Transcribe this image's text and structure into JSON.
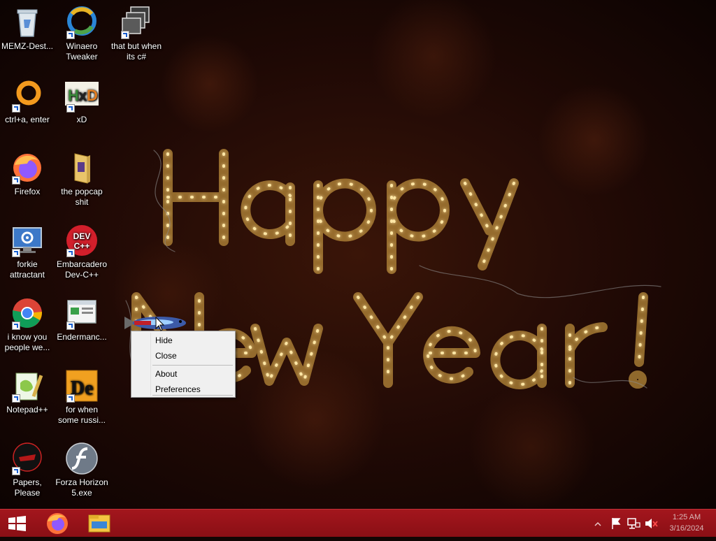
{
  "desktop_icons": [
    {
      "label": "MEMZ-Dest...",
      "icon": "recycle-bin-icon"
    },
    {
      "label": "Winaero Tweaker",
      "icon": "winaero-icon"
    },
    {
      "label": "that but when its c#",
      "icon": "stacked-windows-icon"
    },
    {
      "label": "ctrl+a, enter",
      "icon": "orange-ring-icon"
    },
    {
      "label": "xD",
      "icon": "hxd-icon"
    },
    {
      "label": "Firefox",
      "icon": "firefox-icon"
    },
    {
      "label": "the popcap shit",
      "icon": "folder-icon"
    },
    {
      "label": "forkie attractant",
      "icon": "monitor-gear-icon"
    },
    {
      "label": "Embarcadero Dev-C++",
      "icon": "devcpp-icon"
    },
    {
      "label": "i know you people we...",
      "icon": "chrome-icon"
    },
    {
      "label": "Endermanc...",
      "icon": "window-app-icon"
    },
    {
      "label": "Notepad++",
      "icon": "notepadpp-icon"
    },
    {
      "label": "for when some russi...",
      "icon": "de-icon"
    },
    {
      "label": "Papers, Please",
      "icon": "papers-please-icon"
    },
    {
      "label": "Forza Horizon 5.exe",
      "icon": "flash-icon"
    }
  ],
  "context_menu": {
    "items": [
      "Hide",
      "Close",
      "About",
      "Preferences"
    ]
  },
  "taskbar": {
    "pinned": [
      "start-icon",
      "firefox-icon",
      "file-explorer-icon"
    ],
    "tray": [
      "chevron-up-icon",
      "action-center-flag-icon",
      "network-icon",
      "volume-muted-icon"
    ],
    "time": "1:25 AM",
    "date": "3/16/2024"
  },
  "colors": {
    "taskbar": "#9b131a",
    "menu_bg": "#f0f0f0",
    "light_gold": "#ffd98a"
  }
}
